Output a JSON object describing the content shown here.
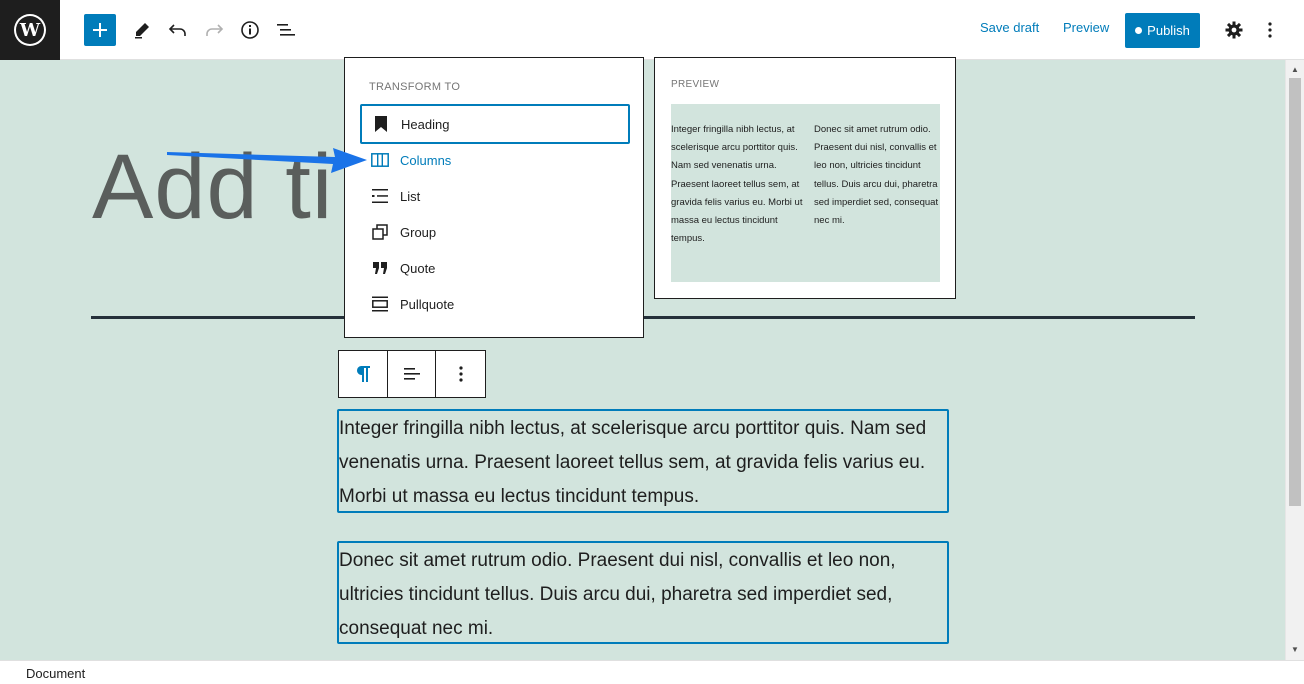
{
  "toolbar": {
    "save_draft_label": "Save draft",
    "preview_label": "Preview",
    "publish_label": "Publish",
    "accent_color": "#007cba"
  },
  "editor": {
    "title_placeholder": "Add ti",
    "paragraphs": [
      "Integer fringilla nibh lectus, at scelerisque arcu porttitor quis. Nam sed venenatis urna. Praesent laoreet tellus sem, at gravida felis varius eu. Morbi ut massa eu lectus tincidunt tempus.",
      "Donec sit amet rutrum odio. Praesent dui nisl, convallis et leo non, ultricies tincidunt tellus. Duis arcu dui, pharetra sed imperdiet sed, consequat nec mi."
    ],
    "background_color": "#d2e4dd"
  },
  "transform_menu": {
    "heading": "TRANSFORM TO",
    "items": [
      {
        "label": "Heading",
        "icon": "bookmark-icon"
      },
      {
        "label": "Columns",
        "icon": "columns-icon"
      },
      {
        "label": "List",
        "icon": "list-icon"
      },
      {
        "label": "Group",
        "icon": "group-icon"
      },
      {
        "label": "Quote",
        "icon": "quote-icon"
      },
      {
        "label": "Pullquote",
        "icon": "pullquote-icon"
      }
    ]
  },
  "preview_panel": {
    "heading": "PREVIEW",
    "col1": "Integer fringilla nibh lectus, at scelerisque arcu porttitor quis. Nam sed venenatis urna. Praesent laoreet tellus sem, at gravida felis varius eu. Morbi ut massa eu lectus tincidunt tempus.",
    "col2": "Donec sit amet rutrum odio. Praesent dui nisl, convallis et leo non, ultricies tincidunt tellus. Duis arcu dui, pharetra sed imperdiet sed, consequat nec mi."
  },
  "footer": {
    "breadcrumb": "Document"
  }
}
